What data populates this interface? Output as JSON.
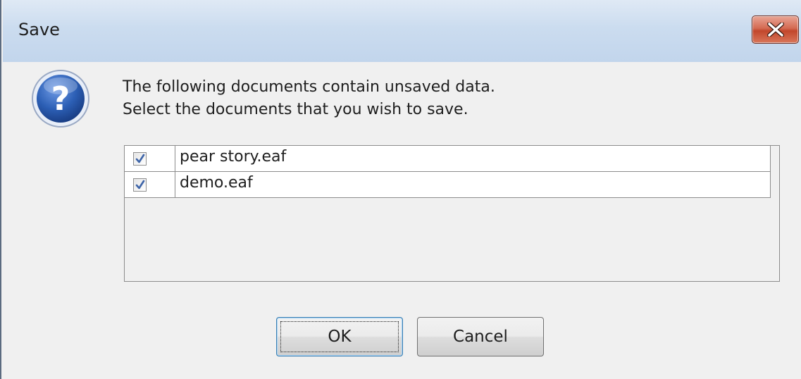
{
  "window": {
    "title": "Save",
    "close_icon": "close-icon"
  },
  "message": {
    "icon": "question-icon",
    "line1": "The following documents contain unsaved data.",
    "line2": "Select the documents that you wish to save."
  },
  "documents": [
    {
      "name": "pear story.eaf",
      "checked": true
    },
    {
      "name": "demo.eaf",
      "checked": true
    }
  ],
  "buttons": {
    "ok_label": "OK",
    "cancel_label": "Cancel"
  },
  "colors": {
    "close_button": "#c2472c",
    "title_bar": "#cbdcef",
    "icon_blue": "#2c5fb5"
  }
}
